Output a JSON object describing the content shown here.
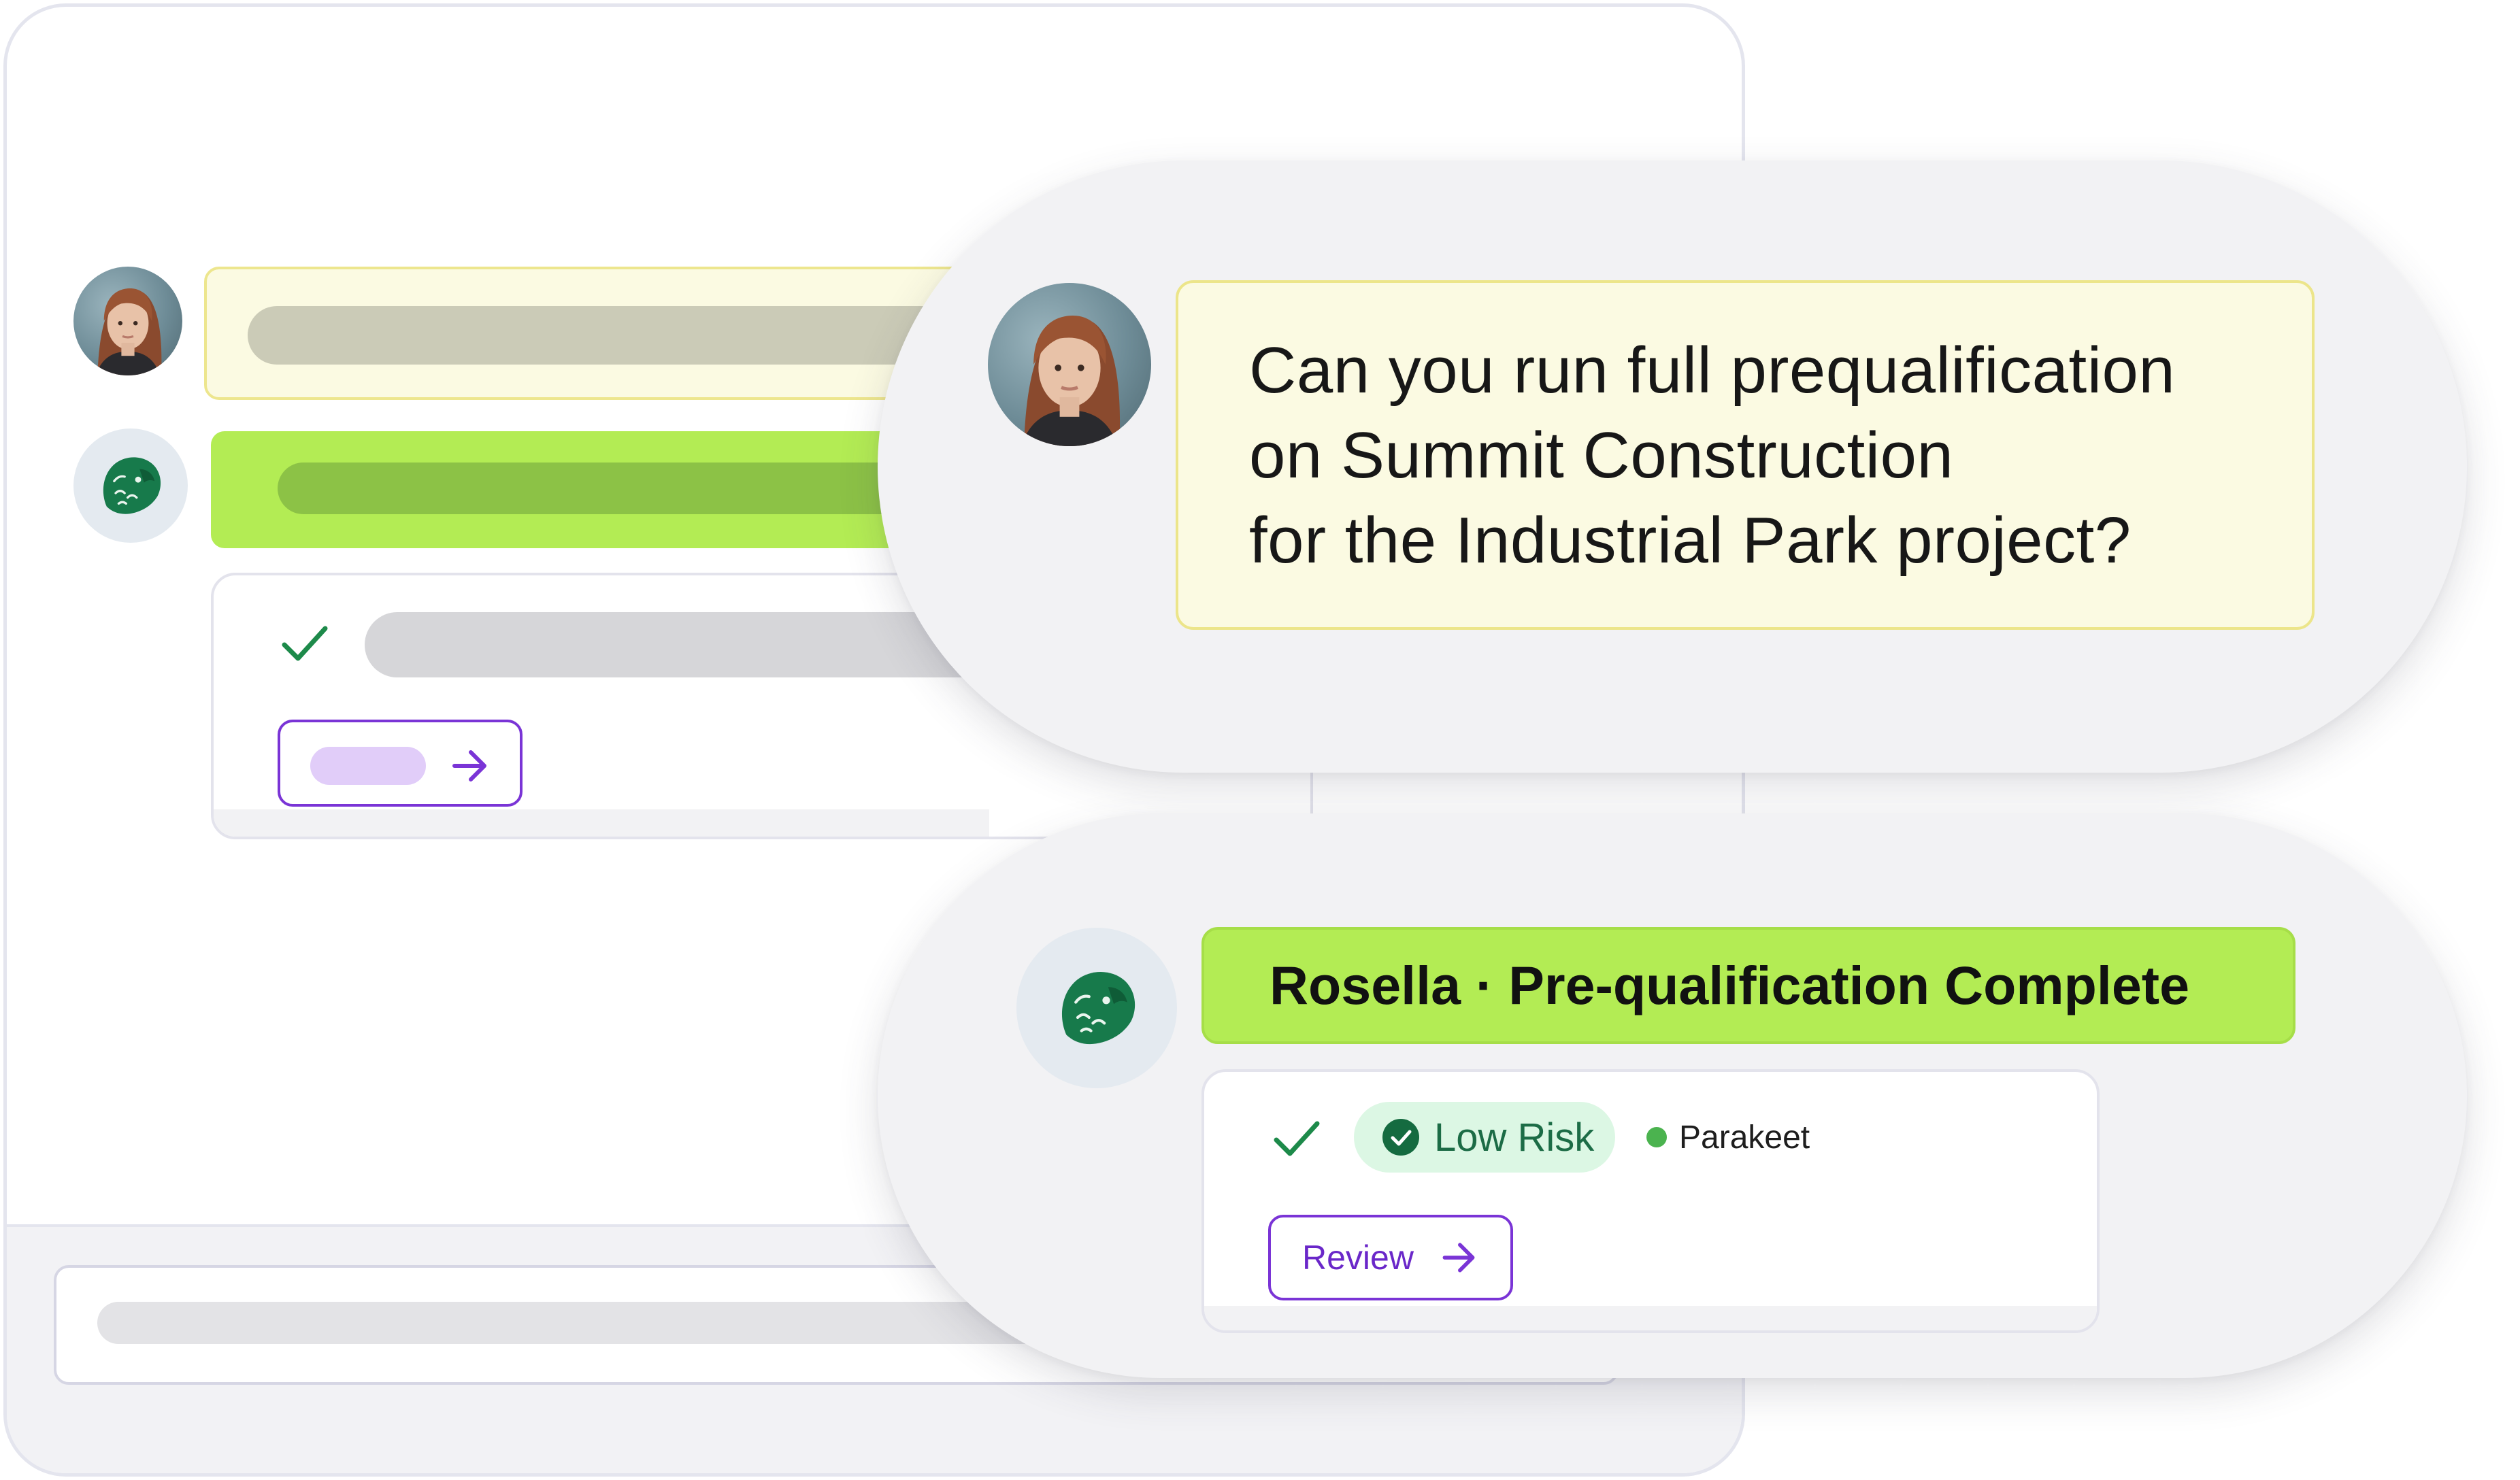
{
  "question": {
    "lines": [
      "Can you run full prequalification",
      "on Summit Construction",
      "for the Industrial Park project?"
    ]
  },
  "result": {
    "title": "Rosella · Pre-qualification Complete",
    "risk_label": "Low Risk",
    "source_label": "Parakeet",
    "review_label": "Review"
  },
  "icons": {
    "user_avatar": "user-avatar-photo",
    "bot_avatar": "parrot-logo",
    "check": "check-icon",
    "check_circle": "check-circle-icon",
    "arrow": "arrow-right-icon",
    "status_dot": "green-dot"
  },
  "colors": {
    "question_bg": "#fbfae2",
    "result_header_bg": "#b3ec54",
    "risk_badge_bg": "#dcf7e4",
    "risk_text": "#1c6c46",
    "accent_purple": "#7a34d6",
    "brand_green": "#177a4b",
    "status_dot": "#4bb34f"
  }
}
